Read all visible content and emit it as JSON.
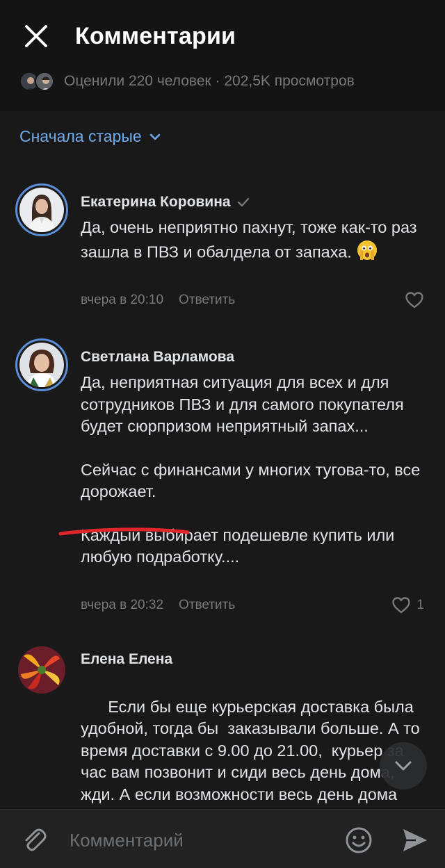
{
  "header": {
    "title": "Комментарии",
    "stats": "Оценили 220 человек · 202,5K просмотров"
  },
  "sort": {
    "label": "Сначала старые"
  },
  "comments": [
    {
      "author": "Екатерина Коровина",
      "verified": true,
      "paragraphs": [
        "Да, очень неприятно пахнут, тоже как-то раз зашла в ПВЗ и обалдела от запаха."
      ],
      "emoji": "face-with-hands-over-eyes",
      "time": "вчера в 20:10",
      "reply": "Ответить",
      "likes": ""
    },
    {
      "author": "Светлана Варламова",
      "verified": false,
      "paragraphs": [
        "Да, неприятная ситуация для всех и для сотрудников ПВЗ и для самого покупателя будет сюрпризом неприятный запах...",
        "Сейчас с финансами у многих тугова-то, все дорожает.",
        "Каждый выбирает подешевле купить или любую подработку...."
      ],
      "time": "вчера в 20:32",
      "reply": "Ответить",
      "likes": "1"
    },
    {
      "author": "Елена Елена",
      "verified": false,
      "paragraphs": [
        "Если бы еще курьерская доставка была удобной, тогда бы  заказывали больше. А то время доставки с 9.00 до 21.00,  курьер за час вам позвонит и сиди весь день дома, жди. А если возможности весь день дома сидеть."
      ]
    }
  ],
  "composer": {
    "placeholder": "Комментарий"
  },
  "colors": {
    "accent": "#71aaeb",
    "background": "#19191a",
    "annotation": "#e0262b"
  }
}
